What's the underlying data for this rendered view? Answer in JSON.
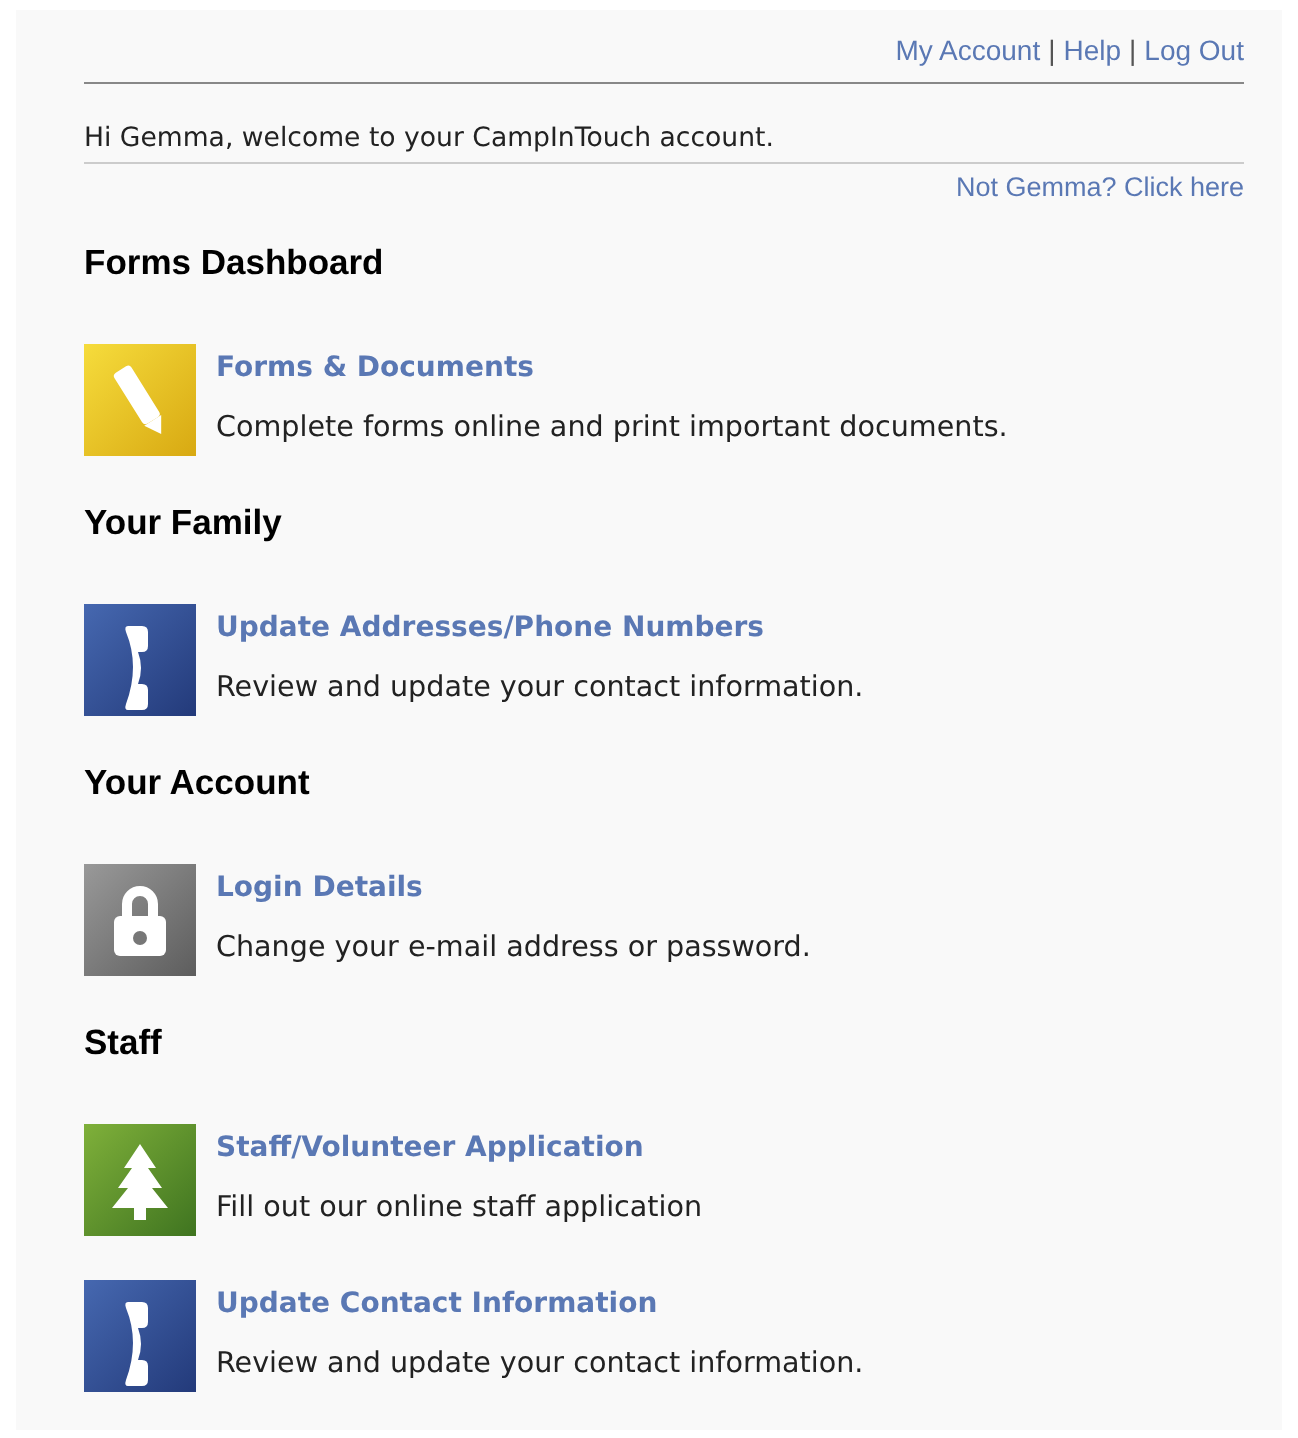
{
  "top_links": [
    {
      "label": "My Account"
    },
    {
      "label": "Help"
    },
    {
      "label": "Log Out"
    }
  ],
  "separator": "|",
  "welcome": "Hi Gemma, welcome to your CampInTouch account.",
  "not_user_link": "Not Gemma? Click here",
  "sections": [
    {
      "title": "Forms Dashboard",
      "items": [
        {
          "kind": "pencil",
          "title": "Forms & Documents",
          "description": "Complete forms online and print important documents."
        }
      ]
    },
    {
      "title": "Your Family",
      "items": [
        {
          "kind": "phone",
          "title": "Update Addresses/Phone Numbers",
          "description": "Review and update your contact information."
        }
      ]
    },
    {
      "title": "Your Account",
      "items": [
        {
          "kind": "lock",
          "title": "Login Details",
          "description": "Change your e-mail address or password."
        }
      ]
    },
    {
      "title": "Staff",
      "items": [
        {
          "kind": "tree",
          "title": "Staff/Volunteer Application",
          "description": "Fill out our online staff application"
        },
        {
          "kind": "phone",
          "title": "Update Contact Information",
          "description": "Review and update your contact information."
        }
      ]
    }
  ]
}
